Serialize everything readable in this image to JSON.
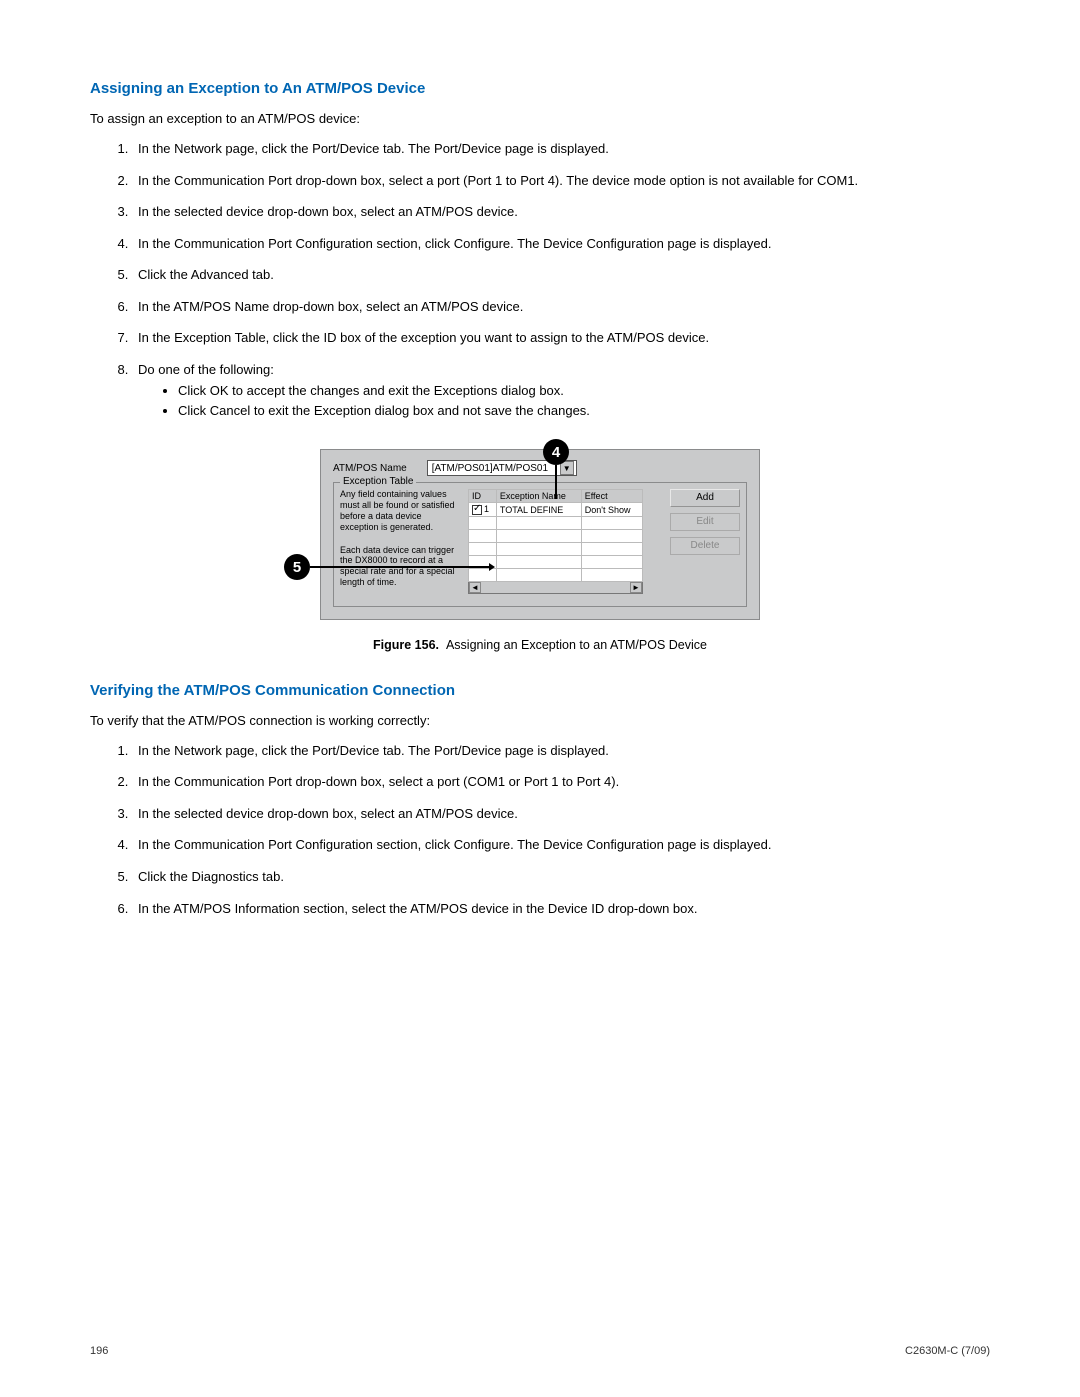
{
  "section1": {
    "heading": "Assigning an Exception to An ATM/POS Device",
    "intro": "To assign an exception to an ATM/POS device:",
    "steps": [
      "In the Network page, click the Port/Device tab. The Port/Device page is displayed.",
      "In the Communication Port drop-down box, select a port (Port 1 to Port 4). The device mode option is not available for COM1.",
      "In the selected device drop-down box, select an ATM/POS device.",
      "In the Communication Port Configuration section, click Configure. The Device Configuration page is displayed.",
      "Click the Advanced tab.",
      "In the ATM/POS Name drop-down box, select an ATM/POS device.",
      "In the Exception Table, click the ID box of the exception you want to assign to the ATM/POS device.",
      "Do one of the following:"
    ],
    "substeps": [
      "Click OK to accept the changes and exit the Exceptions dialog box.",
      "Click Cancel to exit the Exception dialog box and not save the changes."
    ]
  },
  "callouts": {
    "c4": "4",
    "c5": "5"
  },
  "dialog": {
    "name_label": "ATM/POS Name",
    "name_value": "[ATM/POS01]ATM/POS01",
    "fieldset_legend": "Exception Table",
    "note1": "Any field containing values must all be found or satisfied before a data device exception is generated.",
    "note2": "Each data device can trigger the DX8000 to record at a special rate and for a special length of time.",
    "headers": {
      "id": "ID",
      "name": "Exception Name",
      "effect": "Effect"
    },
    "row": {
      "id": "1",
      "name": "TOTAL DEFINE",
      "effect": "Don't Show"
    },
    "buttons": {
      "add": "Add",
      "edit": "Edit",
      "delete": "Delete"
    }
  },
  "figure": {
    "label": "Figure 156.",
    "caption": "Assigning an Exception to an ATM/POS Device"
  },
  "section2": {
    "heading": "Verifying the ATM/POS Communication Connection",
    "intro": "To verify that the ATM/POS connection is working correctly:",
    "steps": [
      "In the Network page, click the Port/Device tab. The Port/Device page is displayed.",
      "In the Communication Port drop-down box, select a port (COM1 or Port 1 to Port 4).",
      "In the selected device drop-down box, select an ATM/POS device.",
      "In the Communication Port Configuration section, click Configure. The Device Configuration page is displayed.",
      "Click the Diagnostics tab.",
      "In the ATM/POS Information section, select the ATM/POS device in the Device ID drop-down box."
    ]
  },
  "footer": {
    "page": "196",
    "doc": "C2630M-C (7/09)"
  }
}
